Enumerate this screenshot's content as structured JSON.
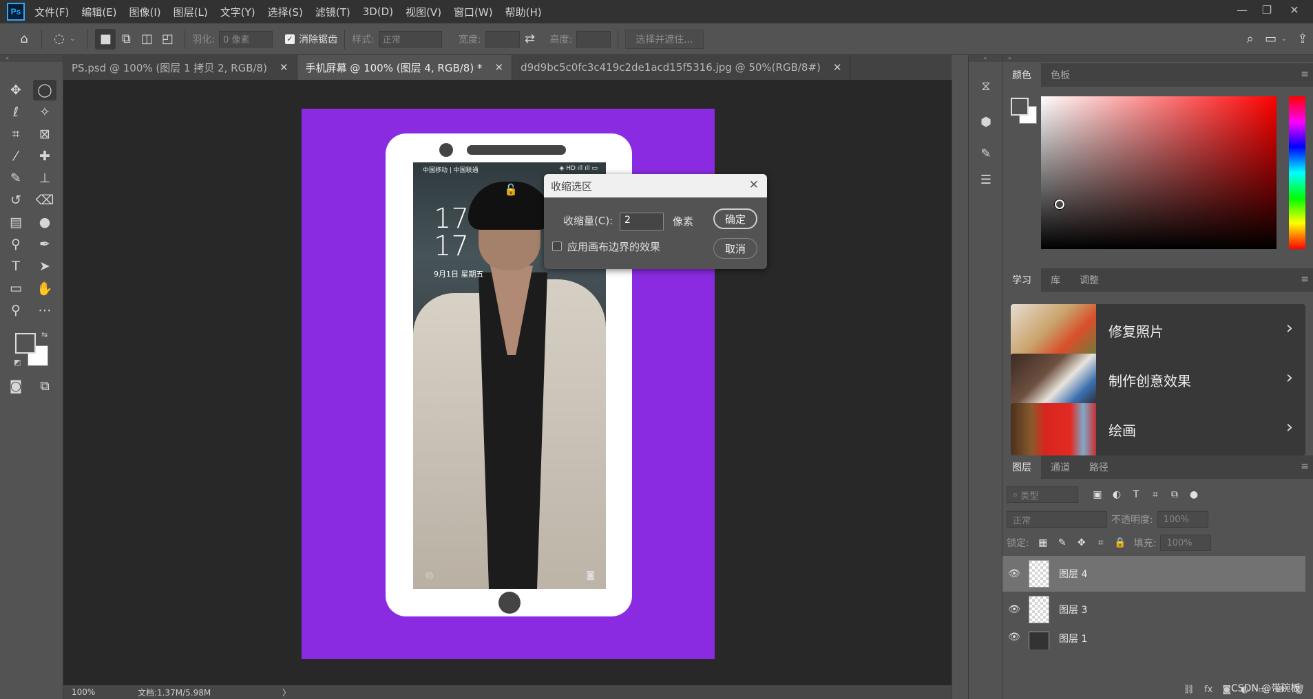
{
  "menubar": {
    "logo": "Ps",
    "items": [
      "文件(F)",
      "编辑(E)",
      "图像(I)",
      "图层(L)",
      "文字(Y)",
      "选择(S)",
      "滤镜(T)",
      "3D(D)",
      "视图(V)",
      "窗口(W)",
      "帮助(H)"
    ]
  },
  "options": {
    "feather_label": "羽化:",
    "feather_value": "0 像素",
    "antialias_label": "消除锯齿",
    "style_label": "样式:",
    "style_value": "正常",
    "width_label": "宽度:",
    "height_label": "高度:",
    "select_mask_label": "选择并遮住..."
  },
  "tabs": [
    {
      "label": "PS.psd @ 100% (图层 1 拷贝 2, RGB/8)",
      "active": false
    },
    {
      "label": "手机屏幕 @ 100% (图层 4, RGB/8) *",
      "active": true
    },
    {
      "label": "d9d9bc5c0fc3c419c2de1acd15f5316.jpg @ 50%(RGB/8#)",
      "active": false
    }
  ],
  "phone_screen": {
    "carrier": "中国移动 | 中国联通",
    "status_right": "◈ HD ıll ıll ▭",
    "hour": "17",
    "minute": "17",
    "date": "9月1日  星期五"
  },
  "dialog": {
    "title": "收缩选区",
    "amount_label": "收缩量(C):",
    "amount_value": "2",
    "unit": "像素",
    "checkbox_label": "应用画布边界的效果",
    "ok_label": "确定",
    "cancel_label": "取消"
  },
  "statusbar": {
    "zoom": "100%",
    "doc_info": "文档:1.37M/5.98M",
    "arrow": "〉"
  },
  "color_panel": {
    "tabs": [
      "颜色",
      "色板"
    ]
  },
  "learn_panel": {
    "tabs": [
      "学习",
      "库",
      "调整"
    ],
    "cards": [
      "修复照片",
      "制作创意效果",
      "绘画"
    ]
  },
  "layers_panel": {
    "tabs": [
      "图层",
      "通道",
      "路径"
    ],
    "filter_placeholder": "类型",
    "blend_mode": "正常",
    "opacity_label": "不透明度:",
    "opacity_value": "100%",
    "lock_label": "锁定:",
    "fill_label": "填充:",
    "fill_value": "100%",
    "layers": [
      {
        "name": "图层 4",
        "selected": true
      },
      {
        "name": "图层 3",
        "selected": false
      },
      {
        "name": "图层 1",
        "selected": false
      }
    ]
  },
  "watermark": "CSDN @带碗板",
  "colors": {
    "canvas_bg": "#8a2be2",
    "ui_dark": "#323232",
    "ui_mid": "#535353"
  }
}
